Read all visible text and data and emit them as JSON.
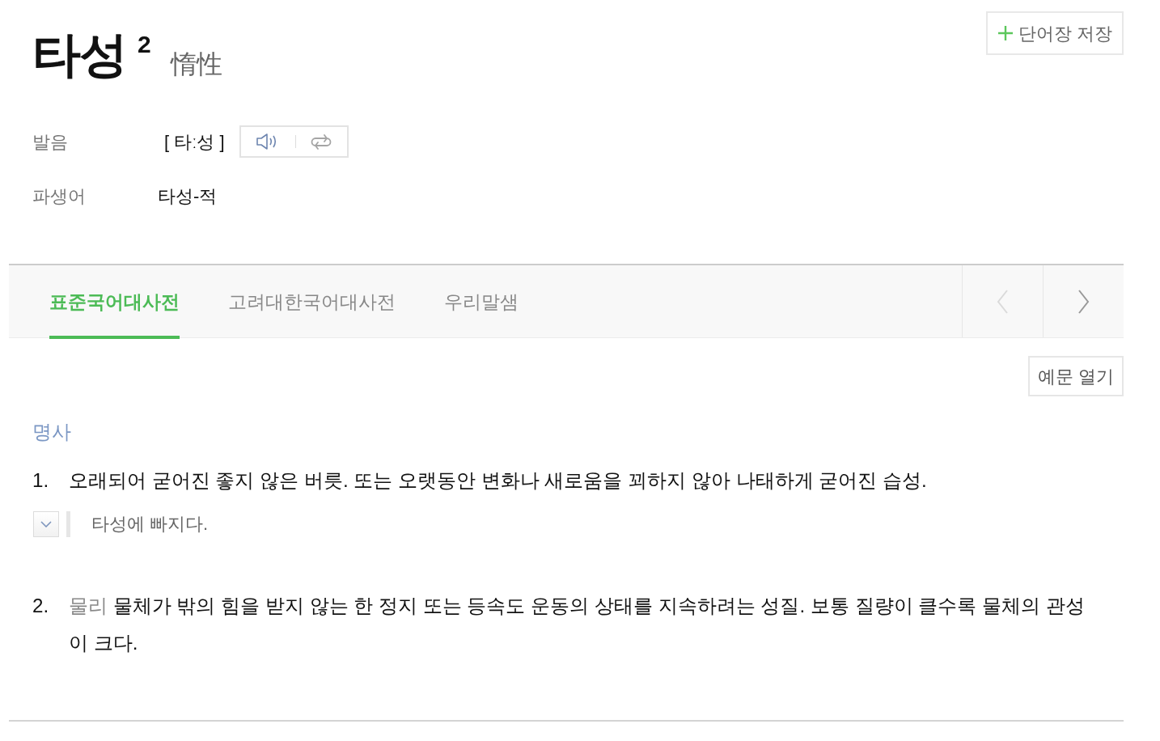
{
  "entry": {
    "headword": "타성",
    "homograph_number": "2",
    "hanja": "惰性"
  },
  "save_button": {
    "label": "단어장 저장"
  },
  "info_rows": [
    {
      "kind": "pronunciation",
      "label": "발음",
      "value": "[ 타ː성 ]"
    },
    {
      "kind": "text",
      "label": "파생어",
      "value": "타성-적"
    }
  ],
  "dictionary_tabs": [
    {
      "label": "표준국어대사전",
      "selected": true
    },
    {
      "label": "고려대한국어대사전",
      "selected": false
    },
    {
      "label": "우리말샘",
      "selected": false
    }
  ],
  "tab_nav": {
    "previous": {
      "disabled": true
    },
    "next": {
      "disabled": false
    }
  },
  "examples_button": {
    "label": "예문 열기"
  },
  "part_of_speech": "명사",
  "senses": [
    {
      "number": "1.",
      "definition": "오래되어 굳어진 좋지 않은 버릇. 또는 오랫동안 변화나 새로움을 꾀하지 않아 나태하게 굳어진 습성.",
      "examples": [
        {
          "text": "타성에 빠지다.",
          "expanded": false
        }
      ]
    },
    {
      "number": "2.",
      "field": "물리",
      "definition": "물체가 밖의 힘을 받지 않는 한 정지 또는 등속도 운동의 상태를 지속하려는 성질. 보통 질량이 클수록 물체의 관성이 크다."
    }
  ]
}
